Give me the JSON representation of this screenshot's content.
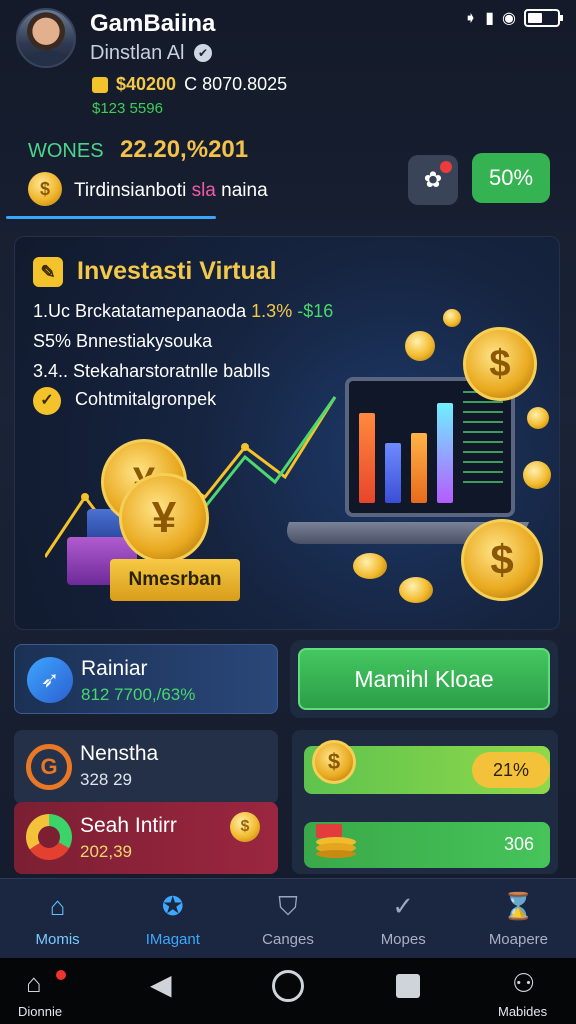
{
  "status_bar": {
    "icons": [
      "nfc-icon",
      "signal-icon",
      "wifi-icon",
      "battery-icon"
    ]
  },
  "header": {
    "app_name": "GamBaiina",
    "sub_name": "Dinstlan Al",
    "balance_main": "$40200",
    "balance_second": "C 8070.8025",
    "balance_change": "$123 5596",
    "money_label": "WONES",
    "money_value": "22.20,%201",
    "promo_text_before": "Tirdinsianboti ",
    "promo_text_highlight": "sla",
    "promo_text_after": " naina",
    "percent_button": "50%"
  },
  "hero": {
    "title": "Investasti Virtual",
    "line1_prefix": "1.Uc",
    "line1_text": "Brckatatamepanaoda",
    "line1_pct": "1.3%",
    "line1_gain": "-$16",
    "line2_prefix": "S5%",
    "line2_text": "Bnnestiakysouka",
    "line3_prefix": "3.4..",
    "line3_text": "Stekaharstoratnlle bablls",
    "line4_text": "Cohtmitalgronpek",
    "stack_label": "Nmesrban",
    "colors": {
      "accent_gold": "#f4c94a",
      "gain_green": "#47d86b"
    }
  },
  "cards": {
    "rain": {
      "title": "Rainiar",
      "sub": "812 7700,/63%"
    },
    "green_button": "Mamihl Kloae",
    "nenstha": {
      "title": "Nenstha",
      "sub": "328 29"
    },
    "seah": {
      "title": "Seah Intirr",
      "sub": "202,39"
    },
    "progress1": {
      "label": "21%",
      "value": 0.78
    },
    "progress2": {
      "label": "306"
    }
  },
  "nav": [
    {
      "label": "Momis",
      "icon": "home-icon"
    },
    {
      "label": "IMagant",
      "icon": "gear-badge-icon"
    },
    {
      "label": "Canges",
      "icon": "shield-icon"
    },
    {
      "label": "Mopes",
      "icon": "check-shield-icon"
    },
    {
      "label": "Moapere",
      "icon": "hourglass-icon"
    }
  ],
  "system_bar": {
    "left_label": "Dionnie",
    "right_label": "Mabides"
  }
}
